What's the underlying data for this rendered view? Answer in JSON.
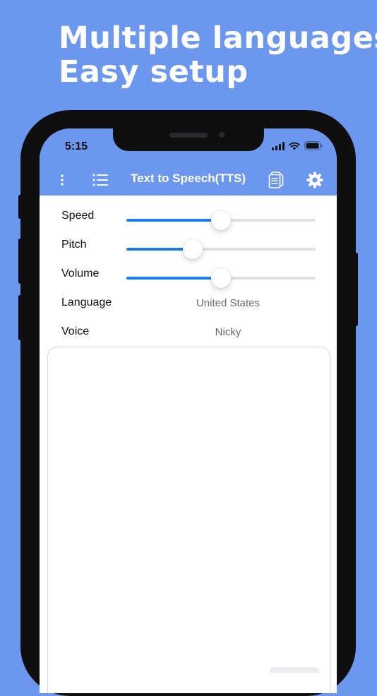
{
  "promo": {
    "line1": "Multiple languages",
    "line2": "Easy setup",
    "background": "#6C97EE"
  },
  "status_bar": {
    "time": "5:15",
    "icons": [
      "signal-icon",
      "wifi-icon",
      "battery-icon"
    ]
  },
  "nav": {
    "title": "Text to Speech(TTS)",
    "left_icons": [
      "more-vertical-icon",
      "list-icon"
    ],
    "right_icons": [
      "documents-icon",
      "gear-icon"
    ],
    "accent": "#6C97EE"
  },
  "settings": {
    "speed": {
      "label": "Speed",
      "value": 0.5
    },
    "pitch": {
      "label": "Pitch",
      "value": 0.35
    },
    "volume": {
      "label": "Volume",
      "value": 0.5
    },
    "language": {
      "label": "Language",
      "value": "United States"
    },
    "voice": {
      "label": "Voice",
      "value": "Nicky"
    },
    "slider_color": "#1a7cf2"
  },
  "text_input": {
    "value": ""
  }
}
